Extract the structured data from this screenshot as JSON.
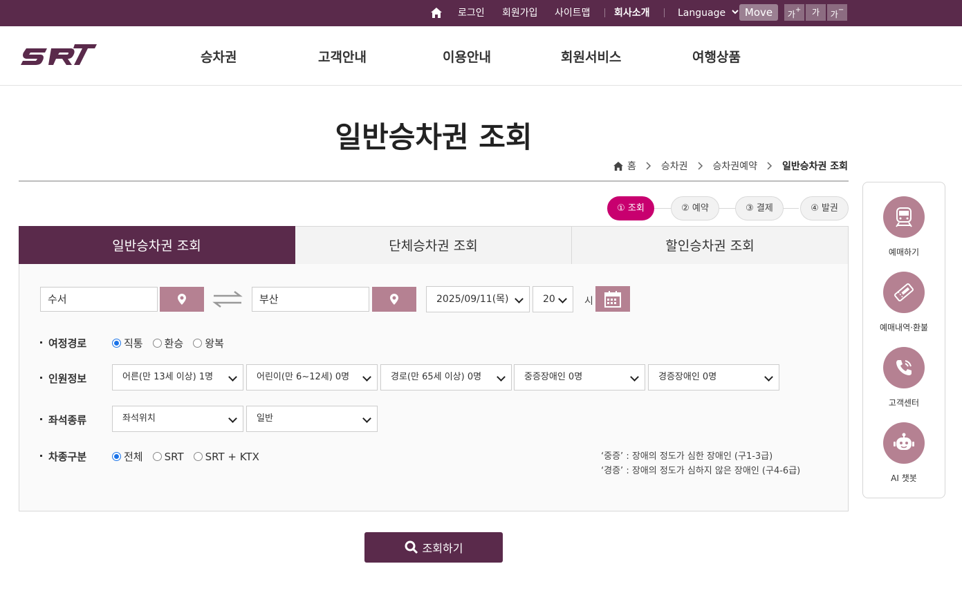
{
  "topbar": {
    "login": "로그인",
    "signup": "회원가입",
    "sitemap": "사이트맵",
    "company": "회사소개",
    "language": "Language",
    "move": "Move",
    "font_up": "가",
    "font_up_sign": "+",
    "font_normal": "가",
    "font_down": "가",
    "font_down_sign": "−"
  },
  "header": {
    "logo_text": "SRT",
    "nav": [
      "승차권",
      "고객안내",
      "이용안내",
      "회원서비스",
      "여행상품"
    ]
  },
  "page": {
    "title": "일반승차권 조회",
    "breadcrumb": [
      "홈",
      "승차권",
      "승차권예약",
      "일반승차권 조회"
    ]
  },
  "steps": [
    "① 조회",
    "② 예약",
    "③ 결제",
    "④ 발권"
  ],
  "tabs": [
    "일반승차권 조회",
    "단체승차권 조회",
    "할인승차권 조회"
  ],
  "search": {
    "departure": "수서",
    "arrival": "부산",
    "date": "2025/09/11(목)",
    "hour": "20",
    "hour_unit": "시"
  },
  "route": {
    "label": "여정경로",
    "options": [
      "직통",
      "환승",
      "왕복"
    ],
    "selected": "직통"
  },
  "passengers": {
    "label": "인원정보",
    "selects": [
      "어른(만 13세 이상) 1명",
      "어린이(만 6~12세) 0명",
      "경로(만 65세 이상) 0명",
      "중증장애인 0명",
      "경증장애인 0명"
    ]
  },
  "seat": {
    "label": "좌석종류",
    "selects": [
      "좌석위치",
      "일반"
    ]
  },
  "train_type": {
    "label": "차종구분",
    "options": [
      "전체",
      "SRT",
      "SRT + KTX"
    ],
    "selected": "전체"
  },
  "notes": [
    "‘중증’ : 장애의 정도가 심한 장애인 (구1-3급)",
    "‘경증’ : 장애의 정도가 심하지 않은 장애인 (구4-6급)"
  ],
  "search_button": "조회하기",
  "quick_menu": [
    "예매하기",
    "예매내역·환불",
    "고객센터",
    "AI 챗봇"
  ],
  "colors": {
    "brand": "#5a2a4b",
    "accent_pink": "#c8006f",
    "button_rose": "#b58192"
  }
}
